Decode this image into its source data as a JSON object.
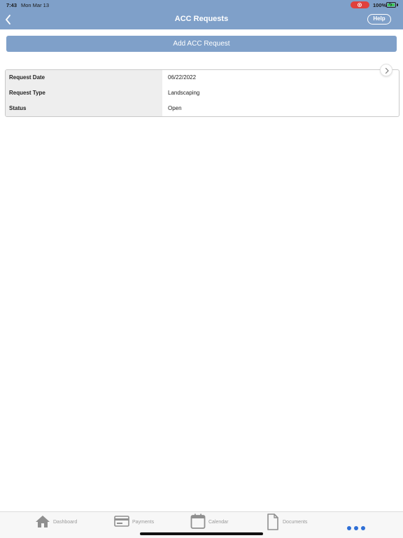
{
  "status_bar": {
    "time": "7:43",
    "date": "Mon Mar 13",
    "battery": "100%"
  },
  "header": {
    "title": "ACC Requests",
    "back_icon": "chevron-left-icon",
    "help_label": "Help"
  },
  "actions": {
    "add_label": "Add ACC Request"
  },
  "request": {
    "rows": [
      {
        "label": "Request Date",
        "value": "06/22/2022"
      },
      {
        "label": "Request Type",
        "value": "Landscaping"
      },
      {
        "label": "Status",
        "value": "Open"
      }
    ],
    "open_icon": "chevron-right-icon"
  },
  "tabs": [
    {
      "label": "Dashboard",
      "icon": "home-icon"
    },
    {
      "label": "Payments",
      "icon": "credit-card-icon"
    },
    {
      "label": "Calendar",
      "icon": "calendar-icon"
    },
    {
      "label": "Documents",
      "icon": "document-icon"
    },
    {
      "label": "",
      "icon": "more-icon"
    }
  ],
  "colors": {
    "header": "#7fa0c9",
    "accent": "#2f6fd6",
    "record": "#e0413d",
    "battery": "#3dc85a"
  }
}
